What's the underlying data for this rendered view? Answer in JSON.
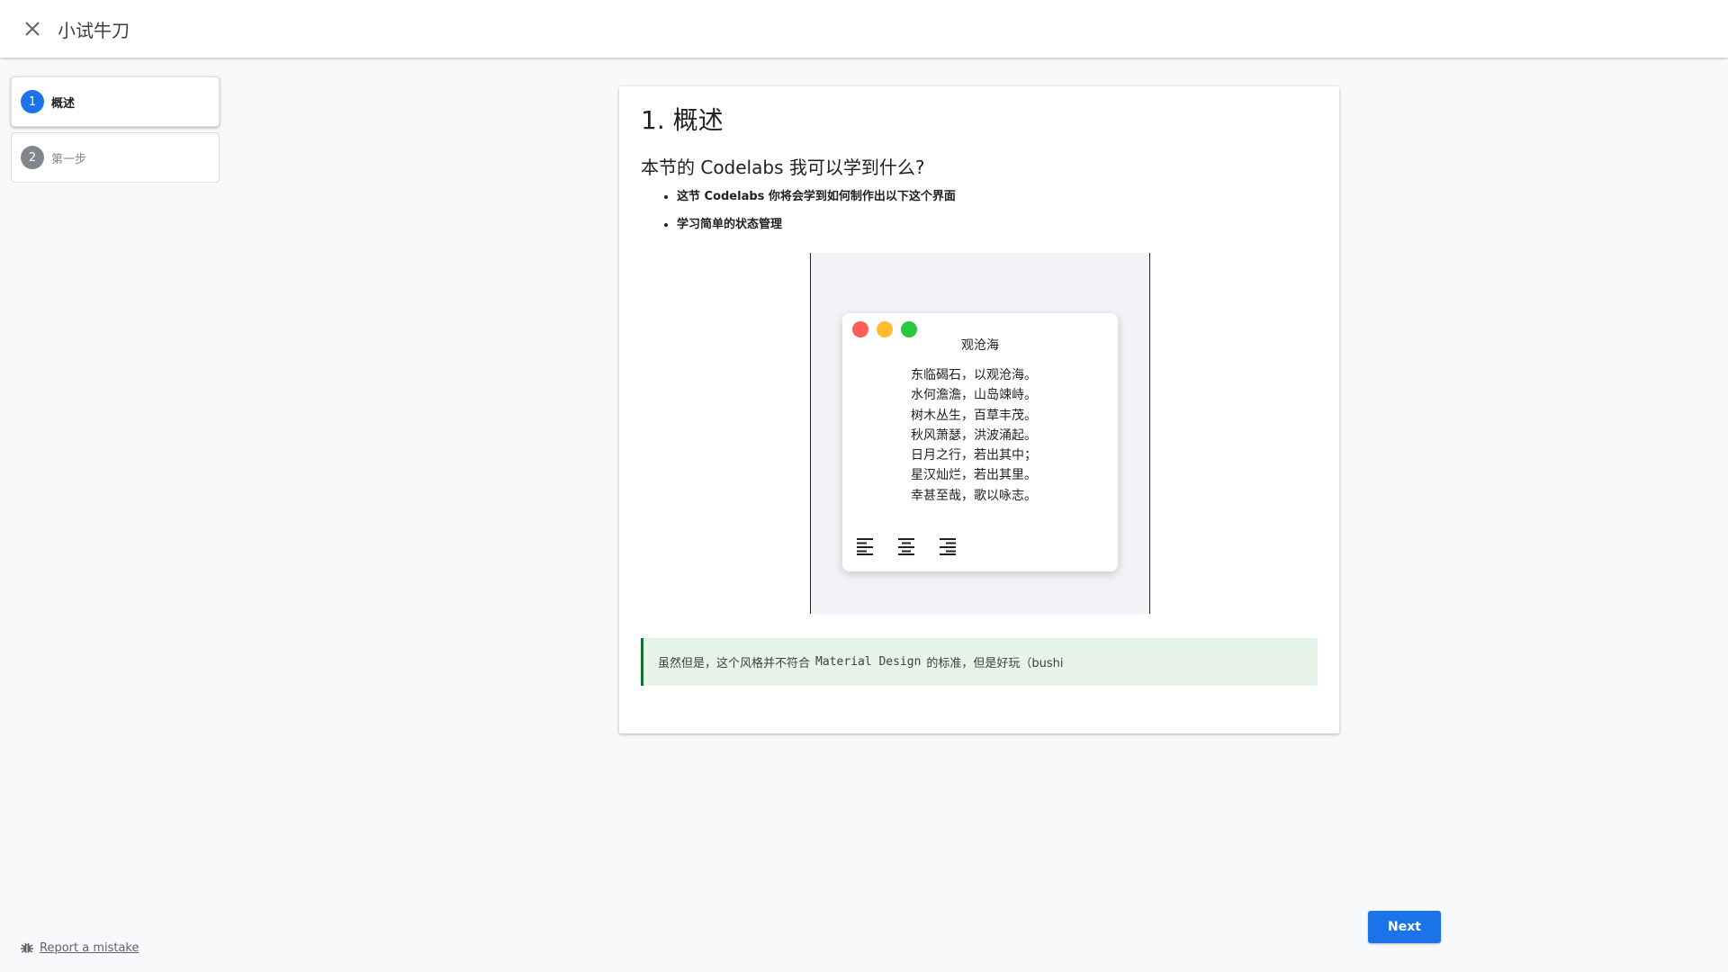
{
  "header": {
    "title": "小试牛刀",
    "close_icon": "close-icon"
  },
  "steps": [
    {
      "number": "1",
      "label": "概述",
      "active": true
    },
    {
      "number": "2",
      "label": "第一步",
      "active": false
    }
  ],
  "content": {
    "heading": "1. 概述",
    "subheading": "本节的 Codelabs 我可以学到什么?",
    "bullets": [
      "这节 Codelabs 你将会学到如何制作出以下这个界面",
      "学习简单的状态管理"
    ],
    "illustration": {
      "window_dots": [
        "#ff5f57",
        "#febc2e",
        "#28c840"
      ],
      "poem_title": "观沧海",
      "poem_lines": [
        "东临碣石，以观沧海。",
        "水何澹澹，山岛竦峙。",
        "树木丛生，百草丰茂。",
        "秋风萧瑟，洪波涌起。",
        "日月之行，若出其中；",
        "星汉灿烂，若出其里。",
        "幸甚至哉，歌以咏志。"
      ],
      "align_icons": [
        "align-left-icon",
        "align-center-icon",
        "align-right-icon"
      ]
    },
    "callout": {
      "before": "虽然但是，这个风格并不符合",
      "code": "Material Design",
      "after": "的标准，但是好玩（bushi"
    }
  },
  "footer": {
    "report_label": "Report a mistake",
    "next_label": "Next"
  },
  "colors": {
    "primary": "#1a73e8",
    "callout_bg": "#e6f4ea",
    "callout_border": "#137333"
  }
}
